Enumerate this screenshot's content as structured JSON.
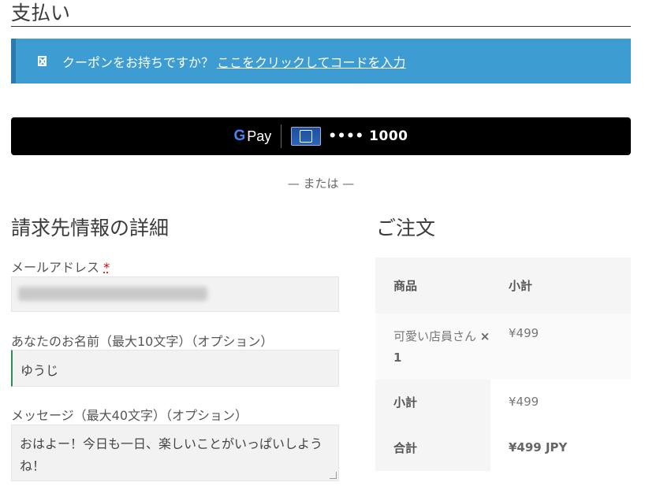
{
  "page": {
    "title": "支払い"
  },
  "coupon": {
    "text": "クーポンをお持ちですか？",
    "link": "ここをクリックしてコードを入力"
  },
  "gpay": {
    "brand": "Pay",
    "card_number": "•••• 1000"
  },
  "separator": "— または —",
  "billing": {
    "title": "請求先情報の詳細",
    "email_label": "メールアドレス",
    "required_mark": "*",
    "name_label": "あなたのお名前（最大10文字）（オプション）",
    "name_value": "ゆうじ",
    "message_label": "メッセージ（最大40文字）（オプション）",
    "message_value": "おはよー！今日も一日、楽しいことがいっぱいしようね！"
  },
  "order": {
    "title": "ご注文",
    "col_product": "商品",
    "col_subtotal": "小計",
    "item_name": "可愛い店員さん",
    "item_qty": "× 1",
    "item_price": "¥499",
    "subtotal_label": "小計",
    "subtotal_value": "¥499",
    "total_label": "合計",
    "total_value": "¥499 JPY"
  },
  "colors": {
    "coupon_bg": "#3d9cd2",
    "gpay_bg": "#000000",
    "name_field_accent": "#2e8b57"
  }
}
